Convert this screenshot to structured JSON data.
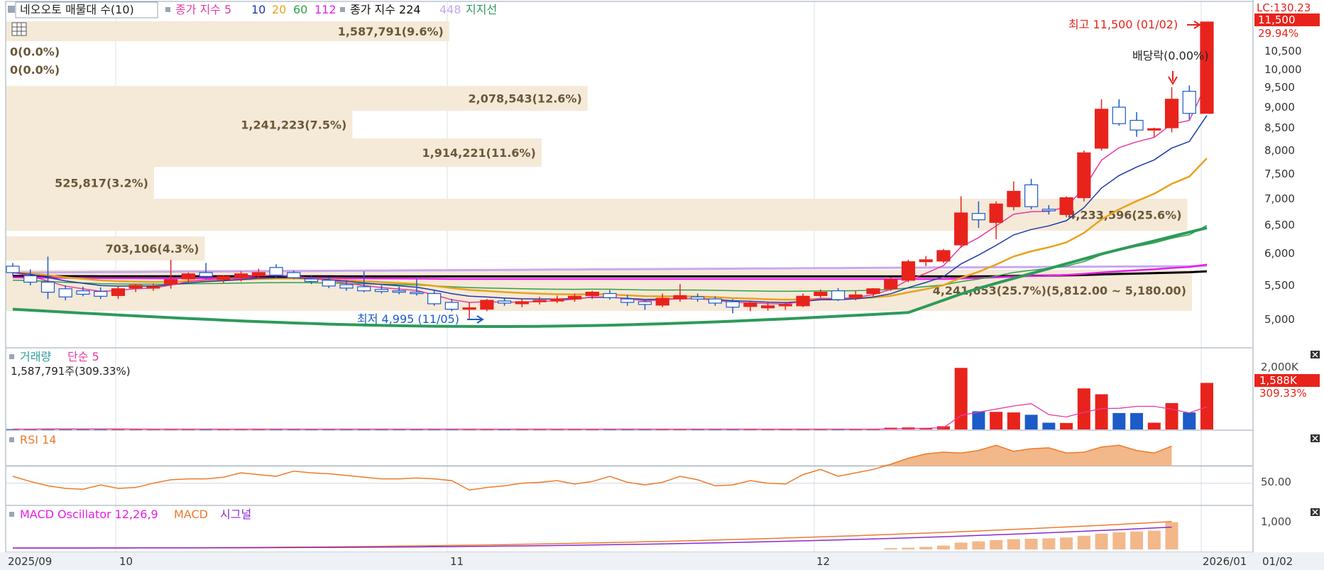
{
  "legend": {
    "main": {
      "item1": "네오오토 매물대 수(10)",
      "ma_prefix": "종가 지수 5",
      "ma10": "10",
      "ma20": "20",
      "ma60": "60",
      "ma112": "112",
      "item2": "종가 지수 224",
      "item3": "448",
      "item4": "지지선"
    },
    "volume": {
      "title": "거래량",
      "ma": "단순 5",
      "value": "1,587,791주(309.33%)"
    },
    "rsi": {
      "title": "RSI 14"
    },
    "macd": {
      "title": "MACD Oscillator 12,26,9",
      "macd": "MACD",
      "signal": "시그널"
    }
  },
  "colors": {
    "up": "#e8231c",
    "down": "#1c5bc8",
    "ma5": "#e83aa0",
    "ma10": "#1d3aa8",
    "ma20": "#e8a21c",
    "ma60": "#2ea34a",
    "ma112": "#e81ce8",
    "ma224": "#000000",
    "ma448": "#c8a8f0",
    "support": "#2e9a5a",
    "profile": "#f5e9d8"
  },
  "price_axis": {
    "ticks": [
      "11,500",
      "10,500",
      "10,000",
      "9,500",
      "9,000",
      "8,500",
      "8,000",
      "7,500",
      "7,000",
      "6,500",
      "6,000",
      "5,500",
      "5,000"
    ],
    "lc": "LC:130.23",
    "last_pct": "29.94%"
  },
  "volume_axis": {
    "ticks": [
      "2,000K"
    ],
    "last": "1,588K",
    "last_pct": "309.33%"
  },
  "rsi_axis": {
    "ticks": [
      "50.00"
    ]
  },
  "macd_axis": {
    "ticks": [
      "1,000"
    ]
  },
  "x_axis": {
    "labels": [
      "2025/09",
      "10",
      "11",
      "12",
      "2026/01"
    ],
    "cursor": "01/02"
  },
  "annotations": {
    "high": "최고 11,500 (01/02)",
    "low": "최저 4,995 (11/05)",
    "dividend": "배당락(0.00%)"
  },
  "chart_data": [
    {
      "type": "candlestick",
      "title": "네오오토",
      "ylim": [
        4800,
        11900
      ],
      "dates": [
        "09/22",
        "09/23",
        "09/24",
        "09/25",
        "09/26",
        "09/29",
        "09/30",
        "10/01",
        "10/02",
        "10/10",
        "10/13",
        "10/14",
        "10/15",
        "10/16",
        "10/17",
        "10/20",
        "10/21",
        "10/22",
        "10/23",
        "10/24",
        "10/27",
        "10/28",
        "10/29",
        "10/30",
        "10/31",
        "11/03",
        "11/04",
        "11/05",
        "11/06",
        "11/07",
        "11/10",
        "11/11",
        "11/12",
        "11/13",
        "11/14",
        "11/17",
        "11/18",
        "11/19",
        "11/20",
        "11/21",
        "11/24",
        "11/25",
        "11/26",
        "11/27",
        "11/28",
        "12/01",
        "12/02",
        "12/03",
        "12/04",
        "12/05",
        "12/08",
        "12/09",
        "12/10",
        "12/11",
        "12/12",
        "12/15",
        "12/16",
        "12/17",
        "12/18",
        "12/19",
        "12/22",
        "12/23",
        "12/24",
        "12/26",
        "12/29",
        "12/30",
        "01/02"
      ],
      "ohlc": [
        [
          5800,
          5850,
          5650,
          5700
        ],
        [
          5650,
          5750,
          5500,
          5550
        ],
        [
          5550,
          5950,
          5300,
          5400
        ],
        [
          5450,
          5500,
          5280,
          5330
        ],
        [
          5420,
          5480,
          5340,
          5370
        ],
        [
          5410,
          5470,
          5300,
          5340
        ],
        [
          5350,
          5500,
          5300,
          5450
        ],
        [
          5460,
          5520,
          5400,
          5500
        ],
        [
          5470,
          5530,
          5420,
          5480
        ],
        [
          5520,
          5900,
          5450,
          5590
        ],
        [
          5600,
          5700,
          5540,
          5680
        ],
        [
          5700,
          5850,
          5600,
          5640
        ],
        [
          5590,
          5660,
          5540,
          5640
        ],
        [
          5620,
          5720,
          5560,
          5680
        ],
        [
          5650,
          5760,
          5600,
          5700
        ],
        [
          5780,
          5830,
          5620,
          5660
        ],
        [
          5700,
          5730,
          5600,
          5620
        ],
        [
          5600,
          5650,
          5520,
          5560
        ],
        [
          5580,
          5630,
          5460,
          5490
        ],
        [
          5510,
          5580,
          5420,
          5460
        ],
        [
          5480,
          5720,
          5400,
          5420
        ],
        [
          5440,
          5500,
          5380,
          5410
        ],
        [
          5420,
          5480,
          5370,
          5400
        ],
        [
          5400,
          5600,
          5350,
          5380
        ],
        [
          5380,
          5420,
          5200,
          5230
        ],
        [
          5250,
          5300,
          5120,
          5150
        ],
        [
          5150,
          5250,
          4995,
          5170
        ],
        [
          5150,
          5300,
          5120,
          5280
        ],
        [
          5270,
          5320,
          5200,
          5240
        ],
        [
          5230,
          5300,
          5180,
          5260
        ],
        [
          5260,
          5330,
          5220,
          5280
        ],
        [
          5270,
          5350,
          5240,
          5300
        ],
        [
          5300,
          5380,
          5260,
          5340
        ],
        [
          5350,
          5420,
          5300,
          5400
        ],
        [
          5380,
          5430,
          5290,
          5320
        ],
        [
          5300,
          5360,
          5200,
          5250
        ],
        [
          5260,
          5300,
          5140,
          5220
        ],
        [
          5210,
          5380,
          5180,
          5310
        ],
        [
          5300,
          5520,
          5260,
          5350
        ],
        [
          5330,
          5380,
          5260,
          5300
        ],
        [
          5300,
          5340,
          5200,
          5240
        ],
        [
          5260,
          5300,
          5090,
          5180
        ],
        [
          5190,
          5260,
          5120,
          5240
        ],
        [
          5170,
          5250,
          5130,
          5200
        ],
        [
          5200,
          5240,
          5140,
          5220
        ],
        [
          5200,
          5380,
          5180,
          5340
        ],
        [
          5350,
          5440,
          5320,
          5400
        ],
        [
          5420,
          5460,
          5270,
          5290
        ],
        [
          5320,
          5420,
          5280,
          5360
        ],
        [
          5380,
          5460,
          5340,
          5450
        ],
        [
          5450,
          5620,
          5420,
          5590
        ],
        [
          5580,
          5900,
          5550,
          5870
        ],
        [
          5870,
          5960,
          5800,
          5900
        ],
        [
          5880,
          6080,
          5850,
          6050
        ],
        [
          6150,
          7050,
          6100,
          6730
        ],
        [
          6720,
          6950,
          6450,
          6600
        ],
        [
          6550,
          6950,
          6250,
          6900
        ],
        [
          6850,
          7350,
          6780,
          7150
        ],
        [
          7280,
          7400,
          6800,
          6850
        ],
        [
          6800,
          6880,
          6700,
          6770
        ],
        [
          6700,
          7050,
          6650,
          7020
        ],
        [
          7020,
          8000,
          6950,
          7950
        ],
        [
          8050,
          9200,
          8000,
          8950
        ],
        [
          9000,
          9200,
          8550,
          8600
        ],
        [
          8680,
          8880,
          8300,
          8450
        ],
        [
          8450,
          8500,
          8300,
          8480
        ],
        [
          8500,
          9500,
          8400,
          9200
        ],
        [
          9400,
          9550,
          8700,
          8850
        ],
        [
          8850,
          11500,
          8850,
          11500
        ]
      ],
      "indicators": [
        "MA5",
        "MA10",
        "MA20",
        "MA60",
        "MA112",
        "MA224",
        "MA448",
        "지지선"
      ],
      "volume_profile": [
        {
          "label": "1,587,791(9.6%)",
          "share": 9.6
        },
        {
          "label": "0(0.0%)",
          "share": 0
        },
        {
          "label": "0(0.0%)",
          "share": 0
        },
        {
          "label": "2,078,543(12.6%)",
          "share": 12.6
        },
        {
          "label": "1,241,223(7.5%)",
          "share": 7.5
        },
        {
          "label": "1,914,221(11.6%)",
          "share": 11.6
        },
        {
          "label": "525,817(3.2%)",
          "share": 3.2
        },
        {
          "label": "4,233,596(25.6%)",
          "share": 25.6
        },
        {
          "label": "703,106(4.3%)",
          "share": 4.3
        },
        {
          "label": "4,241,653(25.7%)(5,812.00 ~ 5,180.00)",
          "share": 25.7
        }
      ]
    },
    {
      "type": "bar",
      "title": "거래량",
      "unit": "K",
      "ylim": [
        0,
        2300
      ],
      "values": [
        12,
        14,
        25,
        15,
        14,
        14,
        13,
        12,
        12,
        12,
        12,
        12,
        12,
        12,
        12,
        12,
        12,
        12,
        12,
        12,
        12,
        12,
        12,
        12,
        12,
        12,
        12,
        12,
        12,
        12,
        12,
        12,
        12,
        12,
        12,
        12,
        12,
        12,
        12,
        12,
        12,
        12,
        12,
        12,
        12,
        12,
        12,
        12,
        12,
        12,
        60,
        70,
        50,
        110,
        2100,
        620,
        600,
        580,
        500,
        230,
        220,
        1400,
        1200,
        560,
        560,
        230,
        900,
        580,
        1588
      ]
    },
    {
      "type": "line",
      "title": "RSI 14",
      "values": [
        58,
        52,
        47,
        44,
        43,
        48,
        44,
        45,
        50,
        54,
        55,
        55,
        57,
        62,
        60,
        58,
        64,
        62,
        61,
        59,
        57,
        55,
        55,
        56,
        55,
        53,
        42,
        45,
        47,
        50,
        51,
        53,
        49,
        52,
        58,
        51,
        48,
        51,
        58,
        54,
        47,
        48,
        53,
        50,
        49,
        60,
        66,
        58,
        62,
        66,
        72,
        79,
        84,
        86,
        85,
        88,
        94,
        87,
        90,
        91,
        85,
        86,
        92,
        94,
        88,
        85,
        93
      ]
    },
    {
      "type": "bar",
      "title": "MACD Oscillator 12,26,9",
      "values": [
        0,
        0,
        0,
        0,
        0,
        0,
        0,
        0,
        0,
        0,
        0,
        0,
        0,
        0,
        0,
        0,
        0,
        0,
        0,
        0,
        0,
        0,
        0,
        0,
        0,
        0,
        0,
        0,
        0,
        0,
        0,
        0,
        0,
        0,
        0,
        0,
        0,
        0,
        0,
        0,
        0,
        0,
        0,
        0,
        0,
        0,
        0,
        0,
        0,
        0,
        15,
        20,
        30,
        45,
        80,
        95,
        110,
        120,
        125,
        130,
        140,
        160,
        185,
        200,
        210,
        220,
        320
      ]
    }
  ]
}
